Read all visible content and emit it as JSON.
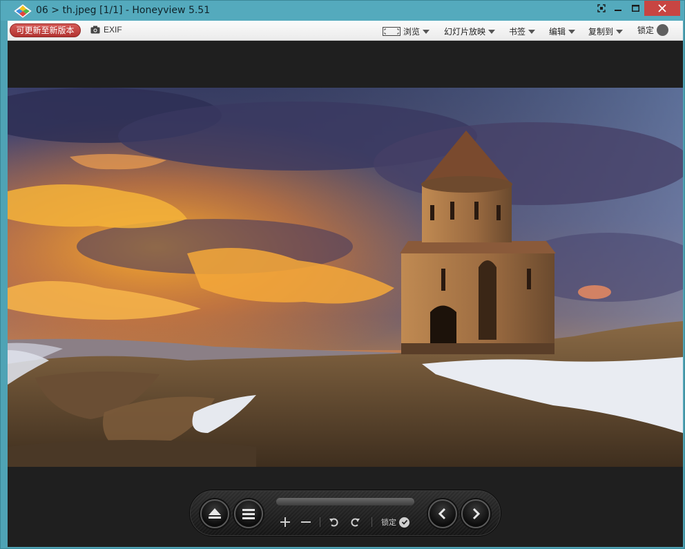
{
  "window": {
    "title": "06 > th.jpeg [1/1] - Honeyview 5.51"
  },
  "toolbar": {
    "update_label": "可更新至新版本",
    "exif_label": "EXIF",
    "menus": [
      {
        "label": "浏览",
        "icon": "view-frame-icon"
      },
      {
        "label": "幻灯片放映"
      },
      {
        "label": "书签"
      },
      {
        "label": "编辑"
      },
      {
        "label": "复制到"
      }
    ],
    "lock_label": "锁定"
  },
  "controls": {
    "lock_label": "锁定",
    "icons": [
      "eject-icon",
      "menu-icon",
      "zoom-in-icon",
      "zoom-out-icon",
      "rotate-left-icon",
      "rotate-right-icon",
      "prev-icon",
      "next-icon"
    ]
  },
  "colors": {
    "titlebar": "#54aabd",
    "close": "#c84542",
    "update_button": "#c0403d",
    "viewer_bg": "#1f1f1f"
  }
}
